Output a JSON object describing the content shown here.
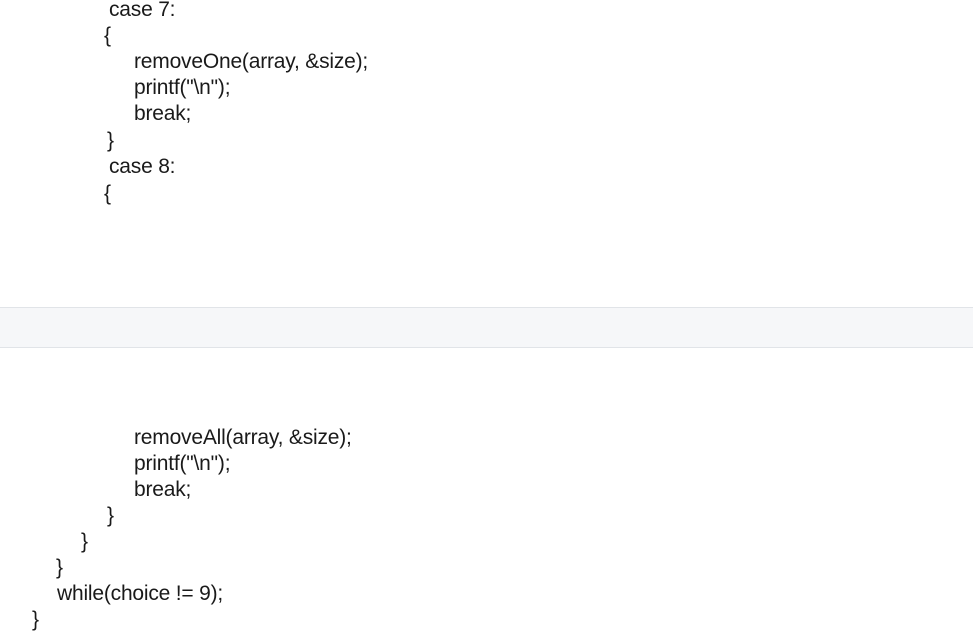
{
  "document": {
    "top_lines": [
      "case 7:",
      "{",
      "removeOne(array, &size);",
      "printf(\"\\n\");",
      "break;",
      "}",
      "case 8:",
      "{"
    ],
    "bottom_lines": [
      "removeAll(array, &size);",
      "printf(\"\\n\");",
      "break;",
      "}",
      "}",
      "}",
      "while(choice != 9);",
      "}"
    ]
  }
}
